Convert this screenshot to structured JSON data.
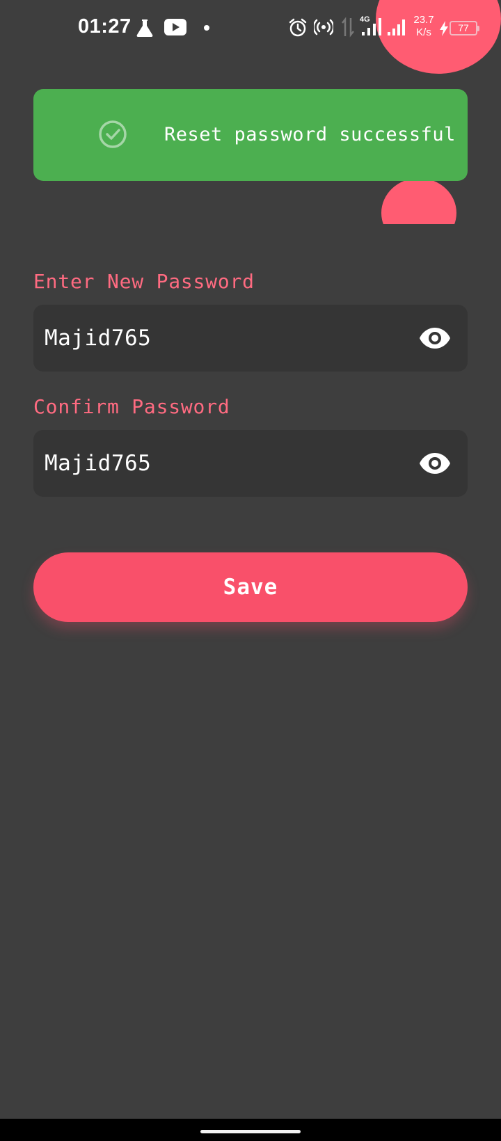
{
  "status_bar": {
    "time": "01:27",
    "net_type": "4G",
    "speed_value": "23.7",
    "speed_unit": "K/s",
    "battery": "77",
    "icons": [
      "flask-icon",
      "youtube-icon",
      "dot-icon",
      "alarm-icon",
      "hotspot-icon",
      "data-arrows-icon",
      "signal-icon",
      "signal-icon",
      "charging-bolt-icon",
      "battery-icon"
    ]
  },
  "toast": {
    "message": "Reset password successful",
    "icon": "check-circle-icon",
    "color": "#4caf50"
  },
  "form": {
    "new_password": {
      "label": "Enter New Password",
      "value": "Majid765",
      "icon": "eye-icon"
    },
    "confirm_password": {
      "label": "Confirm Password",
      "value": "Majid765",
      "icon": "eye-icon"
    },
    "save_label": "Save"
  },
  "colors": {
    "background": "#3e3e3e",
    "accent": "#f9506a",
    "label": "#ff6b81",
    "success": "#4caf50"
  }
}
